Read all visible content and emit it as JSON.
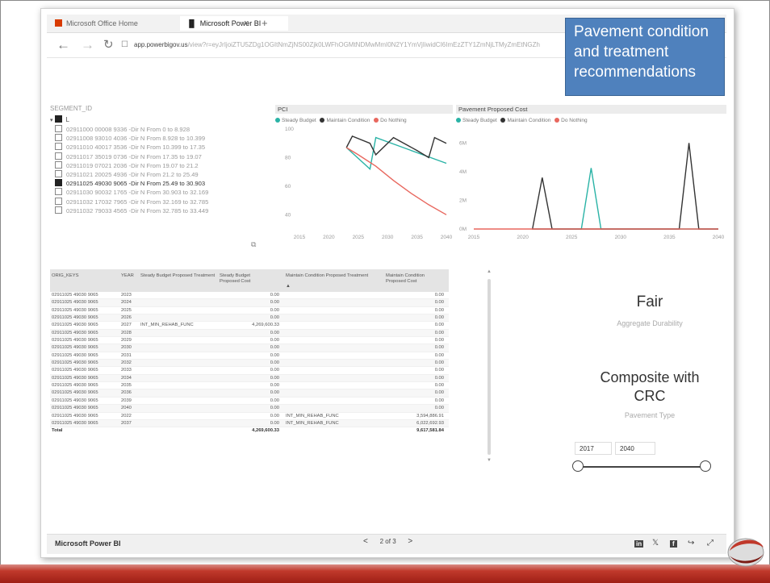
{
  "browser": {
    "tabs": [
      {
        "label": "Microsoft Office Home",
        "icon": "office-icon"
      },
      {
        "label": "Microsoft Power BI",
        "icon": "powerbi-icon"
      }
    ],
    "tab_close": "×",
    "new_tab": "+",
    "url_domain": "app.powerbigov.us",
    "url_rest": "/view?r=eyJrIjoiZTU5ZDg1OGItNmZjNS00Zjk0LWFhOGMtNDMwMmI0N2Y1YmVjIiwidCI6ImEzZTY1ZmNjLTMyZmEtNGZh"
  },
  "callout": {
    "text": "Pavement condition and treatment recommendations"
  },
  "slicer": {
    "title": "SEGMENT_ID",
    "root": "L",
    "items": [
      {
        "label": "02911000 00008 9336 -Dir N From 0 to 8.928",
        "checked": false
      },
      {
        "label": "02911008 93010 4036 -Dir N From 8.928 to 10.399",
        "checked": false
      },
      {
        "label": "02911010 40017 3536 -Dir N From 10.399 to 17.35",
        "checked": false
      },
      {
        "label": "02911017 35019 0736 -Dir N From 17.35 to 19.07",
        "checked": false
      },
      {
        "label": "02911019 07021 2036 -Dir N From 19.07 to 21.2",
        "checked": false
      },
      {
        "label": "02911021 20025 4936 -Dir N From 21.2 to 25.49",
        "checked": false
      },
      {
        "label": "02911025 49030 9065 -Dir N From 25.49 to 30.903",
        "checked": true
      },
      {
        "label": "02911030 90032 1765 -Dir N From 30.903 to 32.169",
        "checked": false
      },
      {
        "label": "02911032 17032 7965 -Dir N From 32.169 to 32.785",
        "checked": false
      },
      {
        "label": "02911032 79033 4565 -Dir N From 32.785 to 33.449",
        "checked": false
      }
    ]
  },
  "colors": {
    "steady": "#2ab3a6",
    "maintain": "#333333",
    "nothing": "#e8675e"
  },
  "legend": [
    "Steady Budget",
    "Maintain Condition",
    "Do Nothing"
  ],
  "chart_data": [
    {
      "type": "line",
      "title": "PCI",
      "x": [
        2015,
        2020,
        2025,
        2030,
        2035,
        2040
      ],
      "ylim": [
        30,
        100
      ],
      "yticks": [
        "100",
        "80",
        "60",
        "40"
      ],
      "xticks": [
        "2015",
        "2020",
        "2025",
        "2030",
        "2035",
        "2040"
      ],
      "series": [
        {
          "name": "Steady Budget",
          "points": [
            [
              2023,
              87
            ],
            [
              2027,
              72
            ],
            [
              2028,
              94
            ],
            [
              2040,
              76
            ]
          ]
        },
        {
          "name": "Maintain Condition",
          "points": [
            [
              2023,
              87
            ],
            [
              2024,
              95
            ],
            [
              2027,
              90
            ],
            [
              2028,
              82
            ],
            [
              2031,
              94
            ],
            [
              2035,
              85
            ],
            [
              2037,
              80
            ],
            [
              2038,
              94
            ],
            [
              2040,
              90
            ]
          ]
        },
        {
          "name": "Do Nothing",
          "points": [
            [
              2023,
              87
            ],
            [
              2025,
              82
            ],
            [
              2028,
              74
            ],
            [
              2031,
              64
            ],
            [
              2034,
              55
            ],
            [
              2037,
              47
            ],
            [
              2040,
              40
            ]
          ]
        }
      ]
    },
    {
      "type": "line",
      "title": "Pavement Proposed Cost",
      "x": [
        2015,
        2020,
        2025,
        2030,
        2035,
        2040
      ],
      "ylim": [
        0,
        7000000
      ],
      "yticks": [
        "6M",
        "4M",
        "2M",
        "0M"
      ],
      "xticks": [
        "2015",
        "2020",
        "2025",
        "2030",
        "2035",
        "2040"
      ],
      "series": [
        {
          "name": "Steady Budget",
          "points": [
            [
              2023,
              0
            ],
            [
              2026,
              0
            ],
            [
              2027,
              4269600
            ],
            [
              2028,
              0
            ],
            [
              2040,
              0
            ]
          ]
        },
        {
          "name": "Maintain Condition",
          "points": [
            [
              2023,
              0
            ],
            [
              2021,
              0
            ],
            [
              2022,
              3594887
            ],
            [
              2023,
              0
            ],
            [
              2036,
              0
            ],
            [
              2037,
              6022693
            ],
            [
              2038,
              0
            ],
            [
              2040,
              0
            ]
          ]
        },
        {
          "name": "Do Nothing",
          "points": [
            [
              2015,
              0
            ],
            [
              2040,
              0
            ]
          ]
        }
      ]
    }
  ],
  "table": {
    "headers": [
      "ORIG_KEYS",
      "YEAR",
      "Steady Budget Proposed Treatment",
      "Steady Budget Proposed Cost",
      "Maintain Condition Proposed Treatment",
      "Maintain Condition Proposed Cost"
    ],
    "rows": [
      [
        "02911025 49030 9065",
        "2023",
        "",
        "0.00",
        "",
        "0.00"
      ],
      [
        "02911025 49030 9065",
        "2024",
        "",
        "0.00",
        "",
        "0.00"
      ],
      [
        "02911025 49030 9065",
        "2025",
        "",
        "0.00",
        "",
        "0.00"
      ],
      [
        "02911025 49030 9065",
        "2026",
        "",
        "0.00",
        "",
        "0.00"
      ],
      [
        "02911025 49030 9065",
        "2027",
        "INT_MIN_REHAB_FUNC",
        "4,269,600.33",
        "",
        "0.00"
      ],
      [
        "02911025 49030 9065",
        "2028",
        "",
        "0.00",
        "",
        "0.00"
      ],
      [
        "02911025 49030 9065",
        "2029",
        "",
        "0.00",
        "",
        "0.00"
      ],
      [
        "02911025 49030 9065",
        "2030",
        "",
        "0.00",
        "",
        "0.00"
      ],
      [
        "02911025 49030 9065",
        "2031",
        "",
        "0.00",
        "",
        "0.00"
      ],
      [
        "02911025 49030 9065",
        "2032",
        "",
        "0.00",
        "",
        "0.00"
      ],
      [
        "02911025 49030 9065",
        "2033",
        "",
        "0.00",
        "",
        "0.00"
      ],
      [
        "02911025 49030 9065",
        "2034",
        "",
        "0.00",
        "",
        "0.00"
      ],
      [
        "02911025 49030 9065",
        "2035",
        "",
        "0.00",
        "",
        "0.00"
      ],
      [
        "02911025 49030 9065",
        "2036",
        "",
        "0.00",
        "",
        "0.00"
      ],
      [
        "02911025 49030 9065",
        "2039",
        "",
        "0.00",
        "",
        "0.00"
      ],
      [
        "02911025 49030 9065",
        "2040",
        "",
        "0.00",
        "",
        "0.00"
      ],
      [
        "02911025 49030 9065",
        "2022",
        "",
        "0.00",
        "INT_MIN_REHAB_FUNC",
        "3,594,886.91"
      ],
      [
        "02911025 49030 9065",
        "2037",
        "",
        "0.00",
        "INT_MIN_REHAB_FUNC",
        "6,022,692.93"
      ]
    ],
    "total_label": "Total",
    "total_steady": "4,269,600.33",
    "total_maintain": "9,617,581.84"
  },
  "cards": {
    "durability_value": "Fair",
    "durability_label": "Aggregate Durability",
    "pavement_value_line1": "Composite with",
    "pavement_value_line2": "CRC",
    "pavement_label": "Pavement Type"
  },
  "year_slider": {
    "start": "2017",
    "end": "2040"
  },
  "footer": {
    "brand": "Microsoft Power BI",
    "page": "2 of 3",
    "prev": "<",
    "next": ">"
  }
}
